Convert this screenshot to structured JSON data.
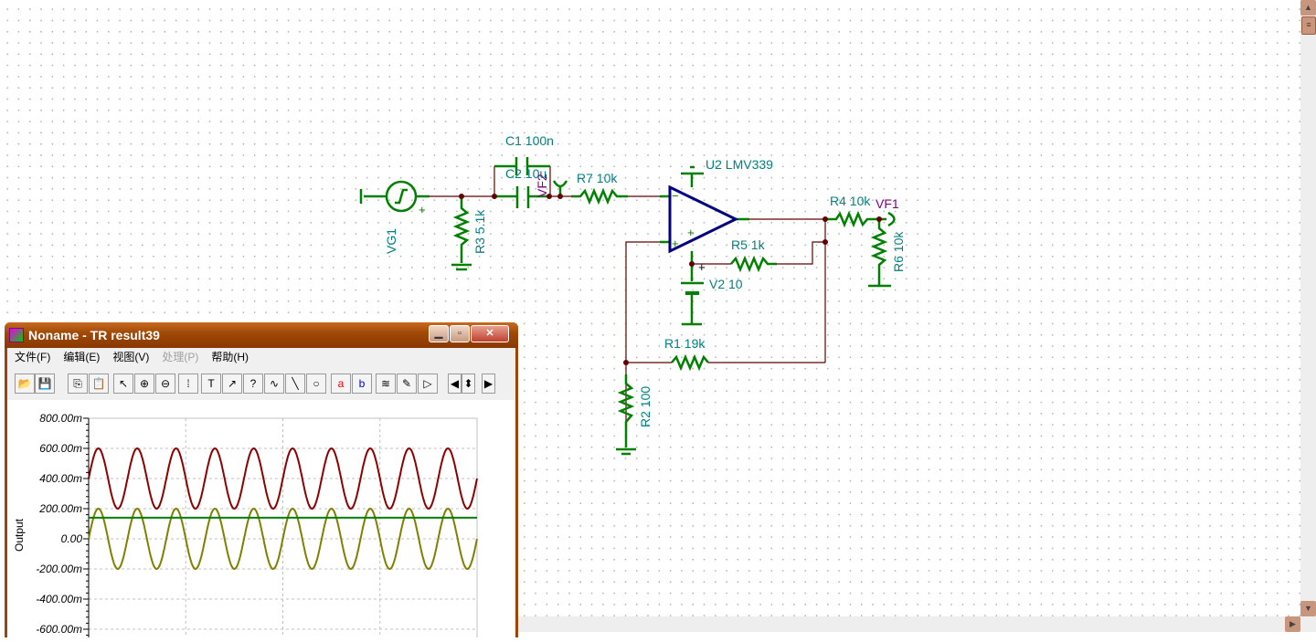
{
  "schematic": {
    "components": [
      {
        "ref": "VG1",
        "label": "VG1"
      },
      {
        "ref": "R3",
        "label": "R3 5.1k"
      },
      {
        "ref": "C1",
        "label": "C1 100n"
      },
      {
        "ref": "C2",
        "label": "C2 10u"
      },
      {
        "ref": "VF2",
        "label": "VF2"
      },
      {
        "ref": "R7",
        "label": "R7 10k"
      },
      {
        "ref": "U2",
        "label": "U2 LMV339"
      },
      {
        "ref": "R4",
        "label": "R4 10k"
      },
      {
        "ref": "VF1",
        "label": "VF1"
      },
      {
        "ref": "R6",
        "label": "R6 10k"
      },
      {
        "ref": "R5",
        "label": "R5 1k"
      },
      {
        "ref": "V2",
        "label": "V2 10"
      },
      {
        "ref": "R1",
        "label": "R1 19k"
      },
      {
        "ref": "R2",
        "label": "R2 100"
      }
    ],
    "colors": {
      "component": "#008000",
      "wire": "#600000",
      "opamp": "#000080",
      "label": "#008080",
      "probe": "#800080"
    }
  },
  "window": {
    "title": "Noname - TR result39",
    "menu": [
      "文件(F)",
      "编辑(E)",
      "视图(V)",
      "处理(P)",
      "帮助(H)"
    ],
    "menu_disabled": [
      "处理(P)"
    ],
    "toolbar": [
      "open-icon",
      "save-icon",
      "copy-icon",
      "paste-icon",
      "pointer-icon",
      "zoom-in-icon",
      "zoom-100-icon",
      "grid-icon",
      "text-icon",
      "curve-label-icon",
      "curve-query-icon",
      "curve-legend-icon",
      "line-icon",
      "circle-icon",
      "cursor-a-icon",
      "cursor-b-icon",
      "add-curve-icon",
      "add-probe-icon",
      "marker-icon",
      "arrow-left-icon",
      "arrow-updown-icon",
      "arrow-right-icon"
    ]
  },
  "chart_data": {
    "type": "line",
    "ylabel": "Output",
    "yticks": [
      "800.00m",
      "600.00m",
      "400.00m",
      "200.00m",
      "0.00",
      "-200.00m",
      "-400.00m",
      "-600.00m"
    ],
    "ylim": [
      -0.6,
      0.8
    ],
    "grid": true,
    "series": [
      {
        "color": "#8b0000",
        "shape": "sine",
        "offset": 0.4,
        "amplitude": 0.2,
        "cycles": 10
      },
      {
        "color": "#808000",
        "shape": "sine",
        "offset": 0.0,
        "amplitude": 0.2,
        "cycles": 10
      },
      {
        "color": "#008000",
        "shape": "constant",
        "offset": 0.14,
        "amplitude": 0,
        "cycles": 0
      }
    ]
  }
}
